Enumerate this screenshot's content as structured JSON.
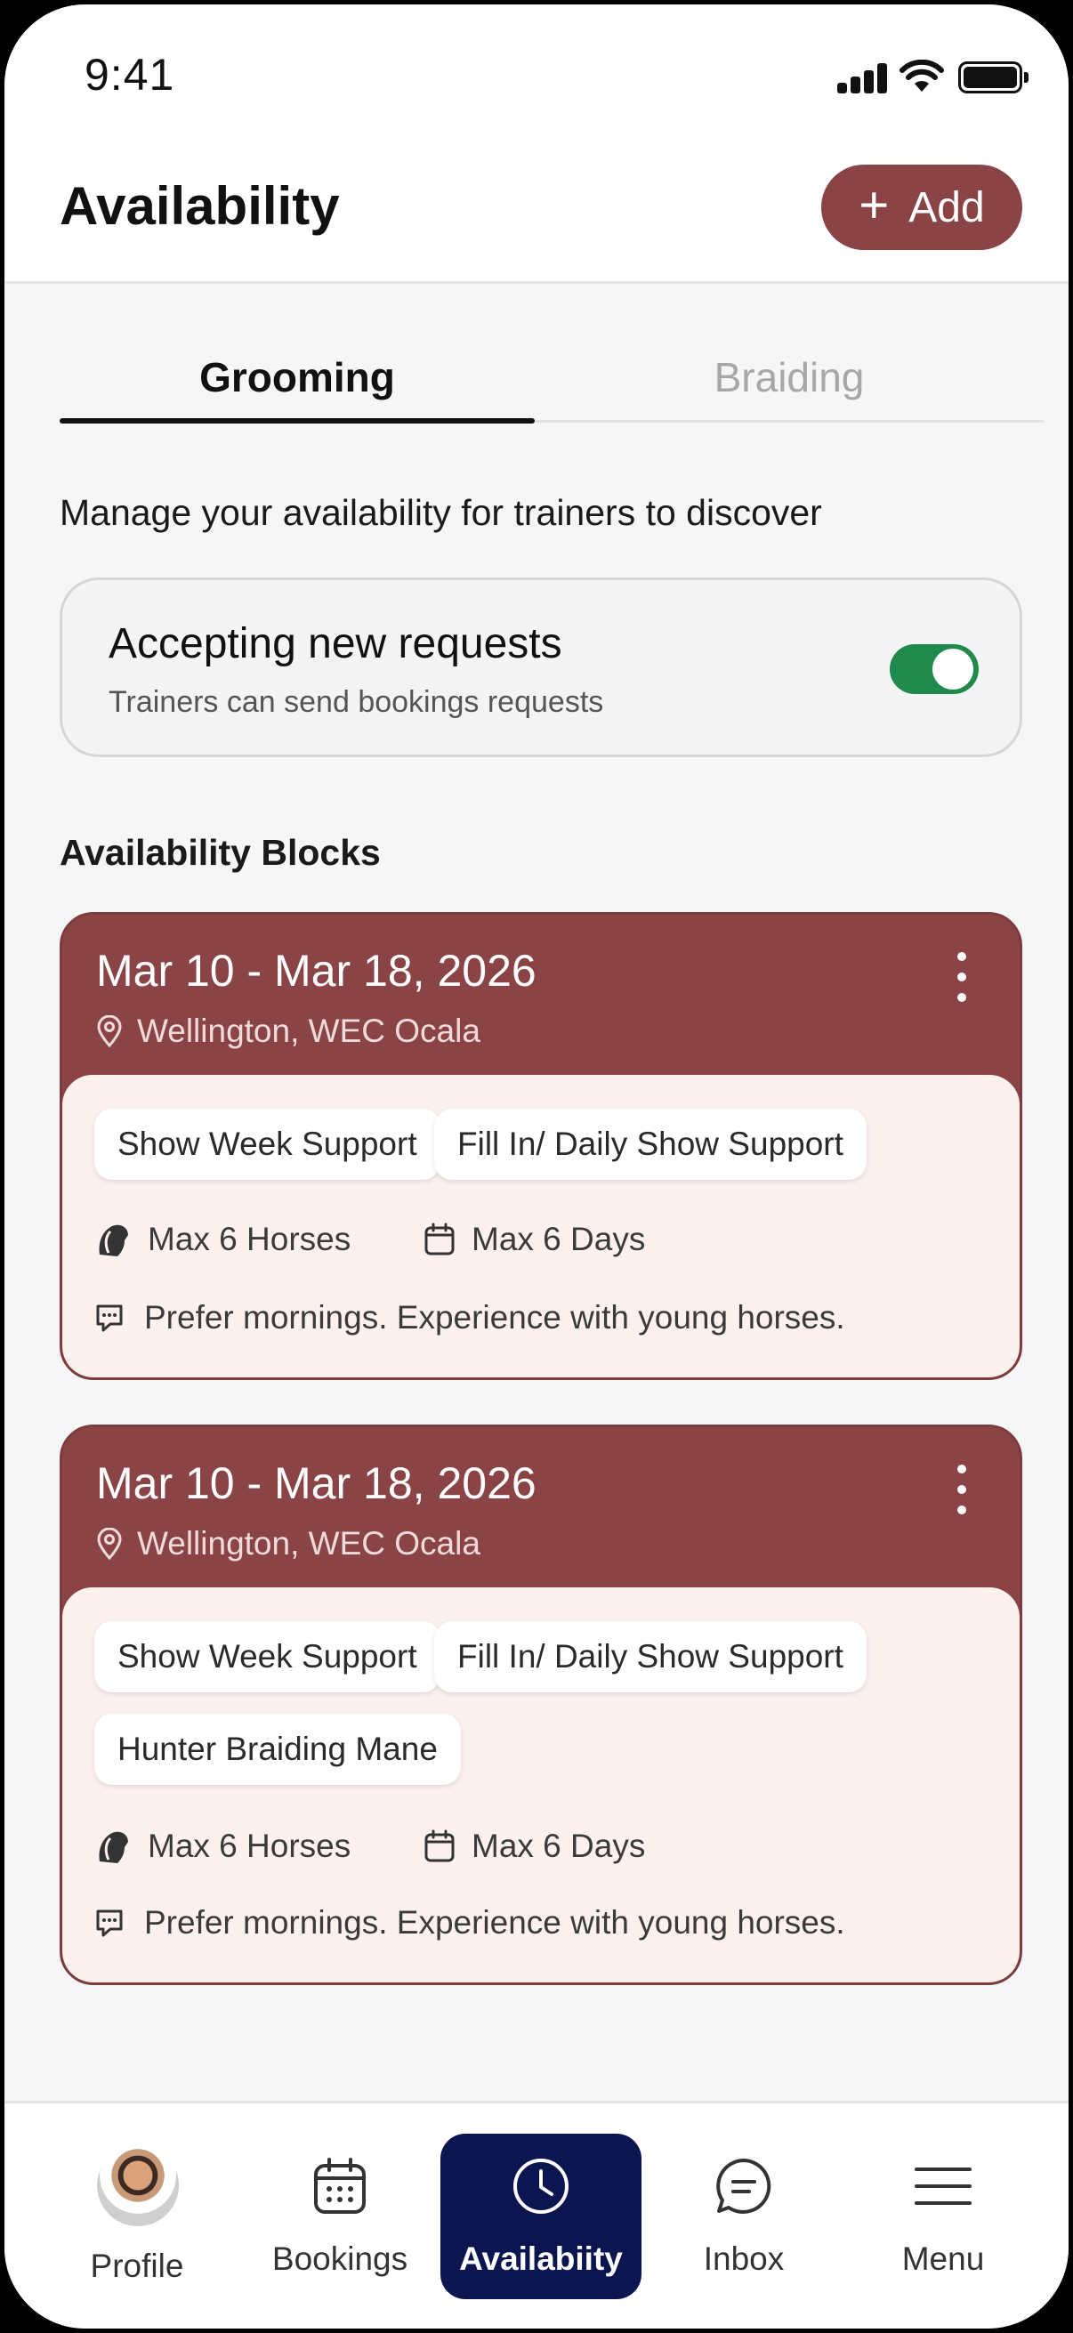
{
  "status_bar": {
    "time": "9:41"
  },
  "header": {
    "title": "Availability",
    "add_label": "Add"
  },
  "tabs": [
    {
      "label": "Grooming",
      "active": true
    },
    {
      "label": "Braiding",
      "active": false
    }
  ],
  "subtitle": "Manage your availability for trainers to discover",
  "accepting": {
    "title": "Accepting new requests",
    "subtitle": "Trainers can send bookings requests",
    "enabled": true
  },
  "blocks_heading": "Availability Blocks",
  "blocks": [
    {
      "date_range": "Mar 10 - Mar 18, 2026",
      "location": "Wellington, WEC Ocala",
      "tags": [
        "Show Week Support",
        "Fill In/ Daily Show Support"
      ],
      "max_horses": "Max 6 Horses",
      "max_days": "Max 6 Days",
      "note": "Prefer mornings. Experience with young horses."
    },
    {
      "date_range": "Mar 10 - Mar 18, 2026",
      "location": "Wellington, WEC Ocala",
      "tags": [
        "Show Week Support",
        "Fill In/ Daily Show Support",
        "Hunter Braiding Mane"
      ],
      "max_horses": "Max 6 Horses",
      "max_days": "Max 6 Days",
      "note": "Prefer mornings. Experience with young horses."
    }
  ],
  "bottom_nav": [
    {
      "label": "Profile",
      "icon": "avatar"
    },
    {
      "label": "Bookings",
      "icon": "calendar-icon"
    },
    {
      "label": "Availabiity",
      "icon": "clock-icon",
      "active": true
    },
    {
      "label": "Inbox",
      "icon": "chat-icon"
    },
    {
      "label": "Menu",
      "icon": "menu-icon"
    }
  ],
  "colors": {
    "accent": "#8b4445",
    "card_body": "#fdf1f0",
    "toggle_on": "#1f8a4c",
    "nav_active": "#0b1650"
  }
}
